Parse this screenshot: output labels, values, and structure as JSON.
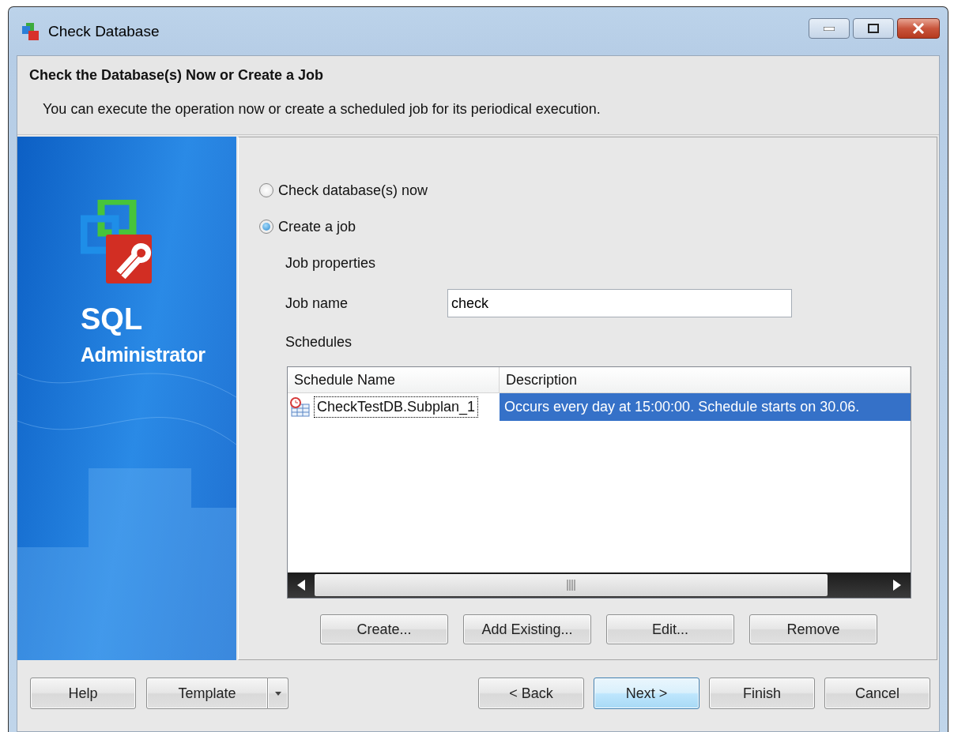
{
  "window": {
    "title": "Check Database"
  },
  "header": {
    "title": "Check the Database(s) Now or Create a Job",
    "subtitle": "You can execute the operation now or create a scheduled job for its periodical execution."
  },
  "sidebar": {
    "product_name": "SQL",
    "product_subtitle": "Administrator"
  },
  "options": [
    {
      "label": "Check database(s) now",
      "selected": false
    },
    {
      "label": "Create a job",
      "selected": true
    }
  ],
  "job": {
    "section_label": "Job properties",
    "name_label": "Job name",
    "name_value": "check",
    "schedules_label": "Schedules"
  },
  "schedules": {
    "columns": [
      "Schedule Name",
      "Description"
    ],
    "rows": [
      {
        "cells": [
          "CheckTestDB.Subplan_1",
          "Occurs every day at 15:00:00. Schedule starts on 30.06."
        ],
        "selected": true
      }
    ]
  },
  "schedule_buttons": [
    "Create...",
    "Add Existing...",
    "Edit...",
    "Remove"
  ],
  "footer_buttons": [
    {
      "label": "Help",
      "kind": "plain"
    },
    {
      "label": "Template",
      "kind": "split"
    },
    {
      "label": "< Back",
      "kind": "plain"
    },
    {
      "label": "Next >",
      "kind": "default"
    },
    {
      "label": "Finish",
      "kind": "plain"
    },
    {
      "label": "Cancel",
      "kind": "plain"
    }
  ]
}
